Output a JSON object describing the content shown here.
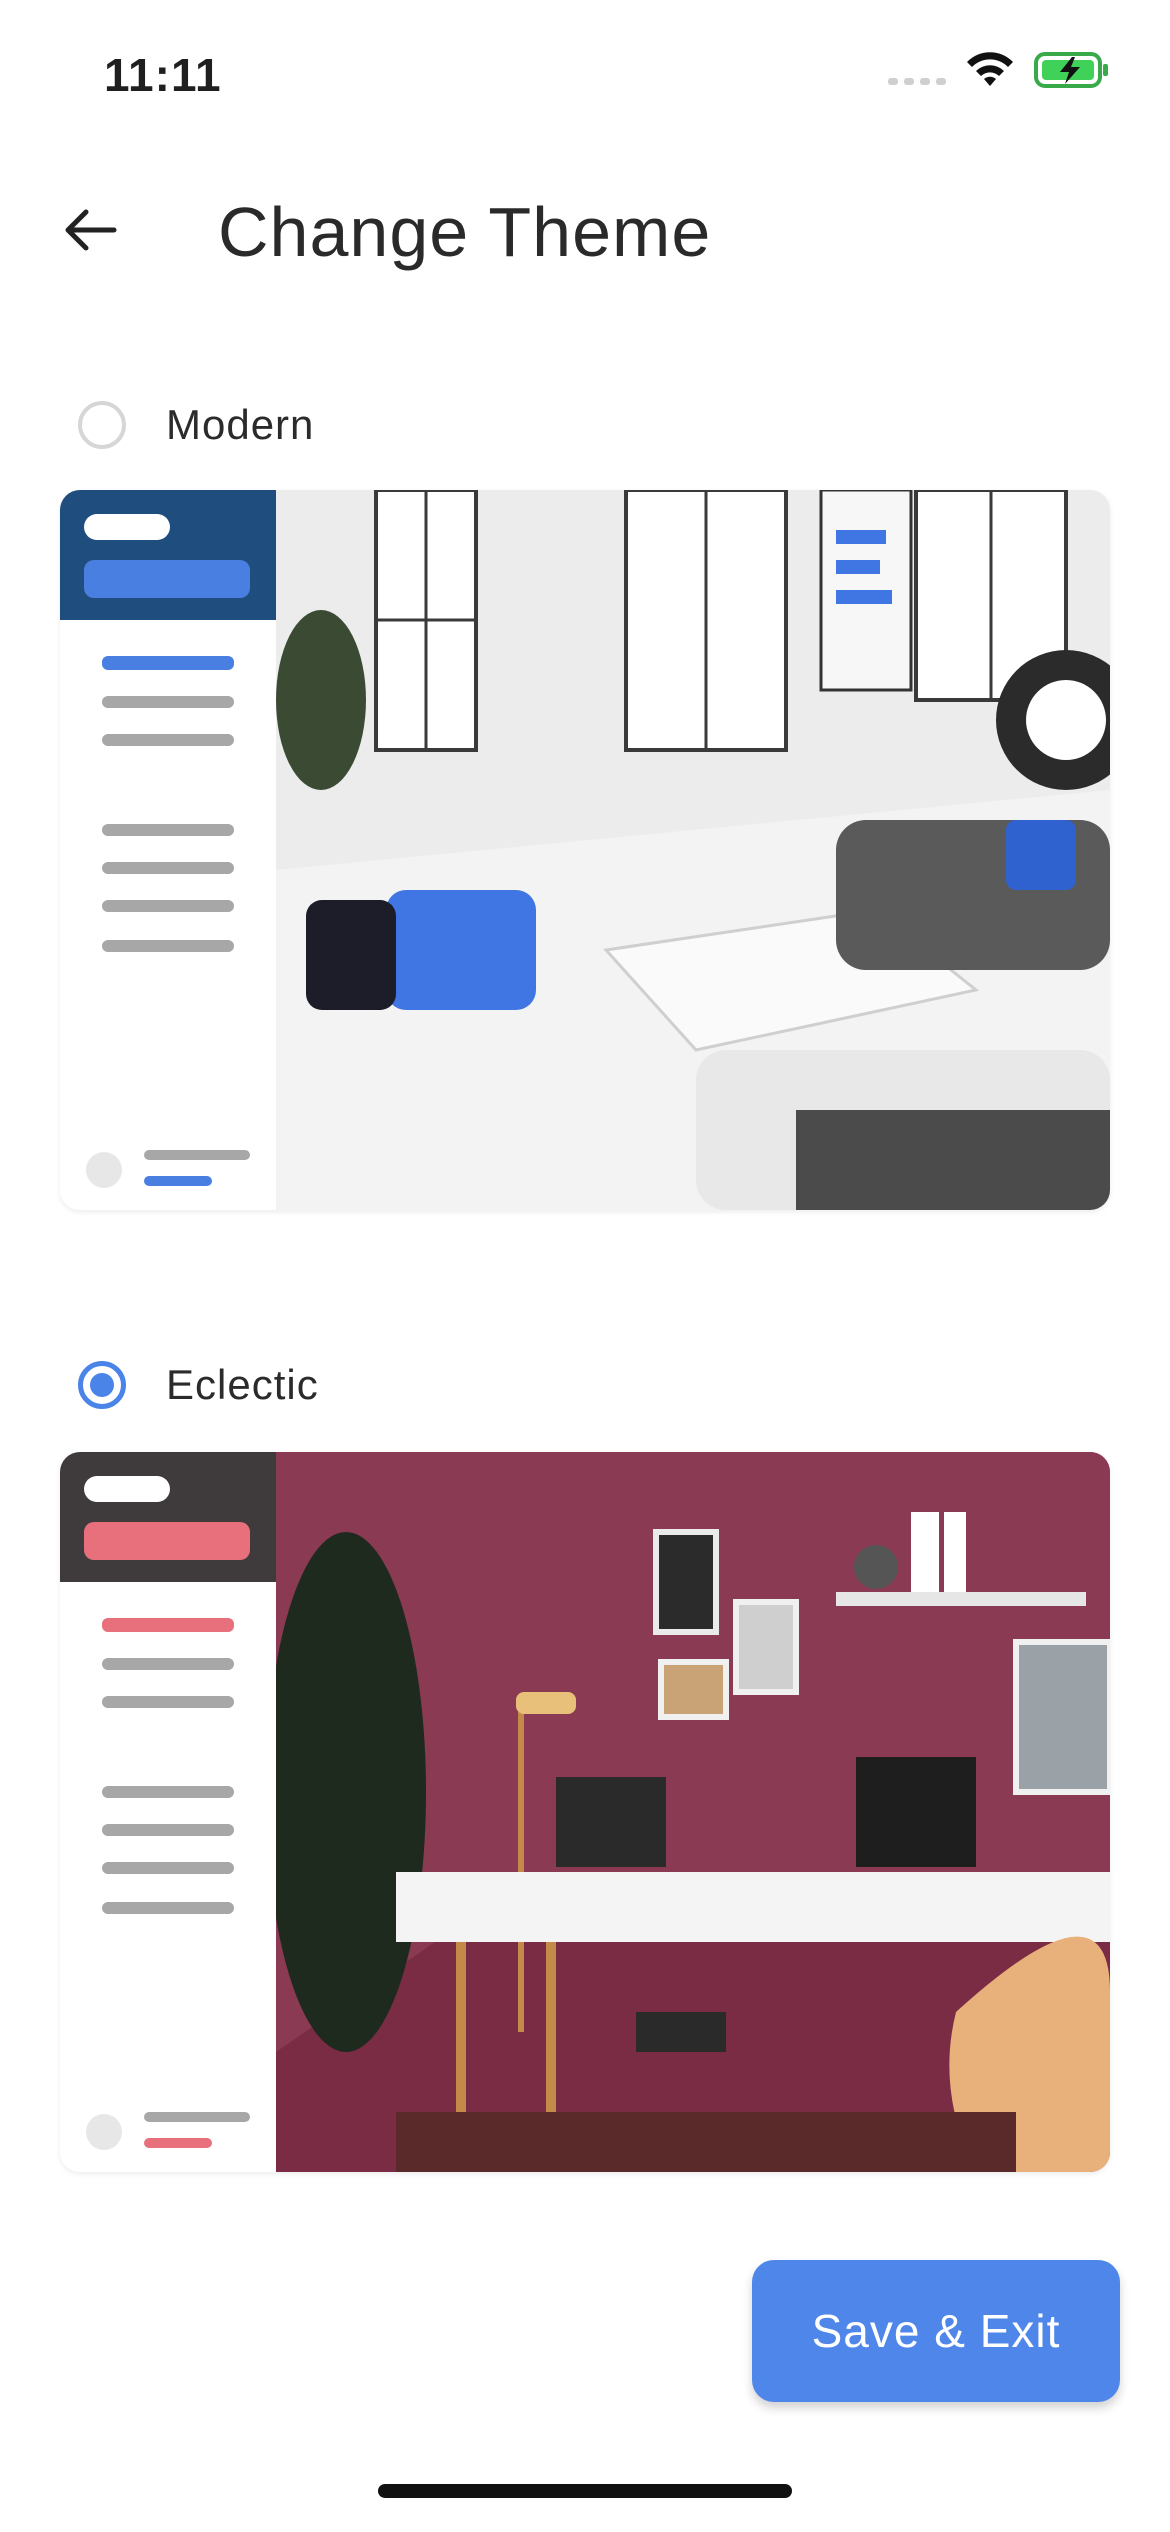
{
  "status_bar": {
    "time": "11:11",
    "icons": [
      "signal-icon",
      "wifi-icon",
      "battery-charging-icon"
    ]
  },
  "header": {
    "title": "Change Theme",
    "back_icon": "arrow-left-icon"
  },
  "themes": [
    {
      "label": "Modern",
      "selected": false,
      "sidebar_color": "#1f4e7e",
      "accent_color": "#4a7fe2",
      "photo_description_colors": [
        "#e9e9e9",
        "#3f76e3",
        "#555555"
      ]
    },
    {
      "label": "Eclectic",
      "selected": true,
      "sidebar_color": "#3f3a3b",
      "accent_color": "#e8707c",
      "photo_description_colors": [
        "#7a2c44",
        "#ffffff",
        "#c48a4a"
      ]
    }
  ],
  "actions": {
    "save_label": "Save & Exit"
  },
  "colors": {
    "primary": "#4f86ea",
    "radio_checked": "#4a84e8",
    "radio_unchecked": "#d6d6d6"
  }
}
